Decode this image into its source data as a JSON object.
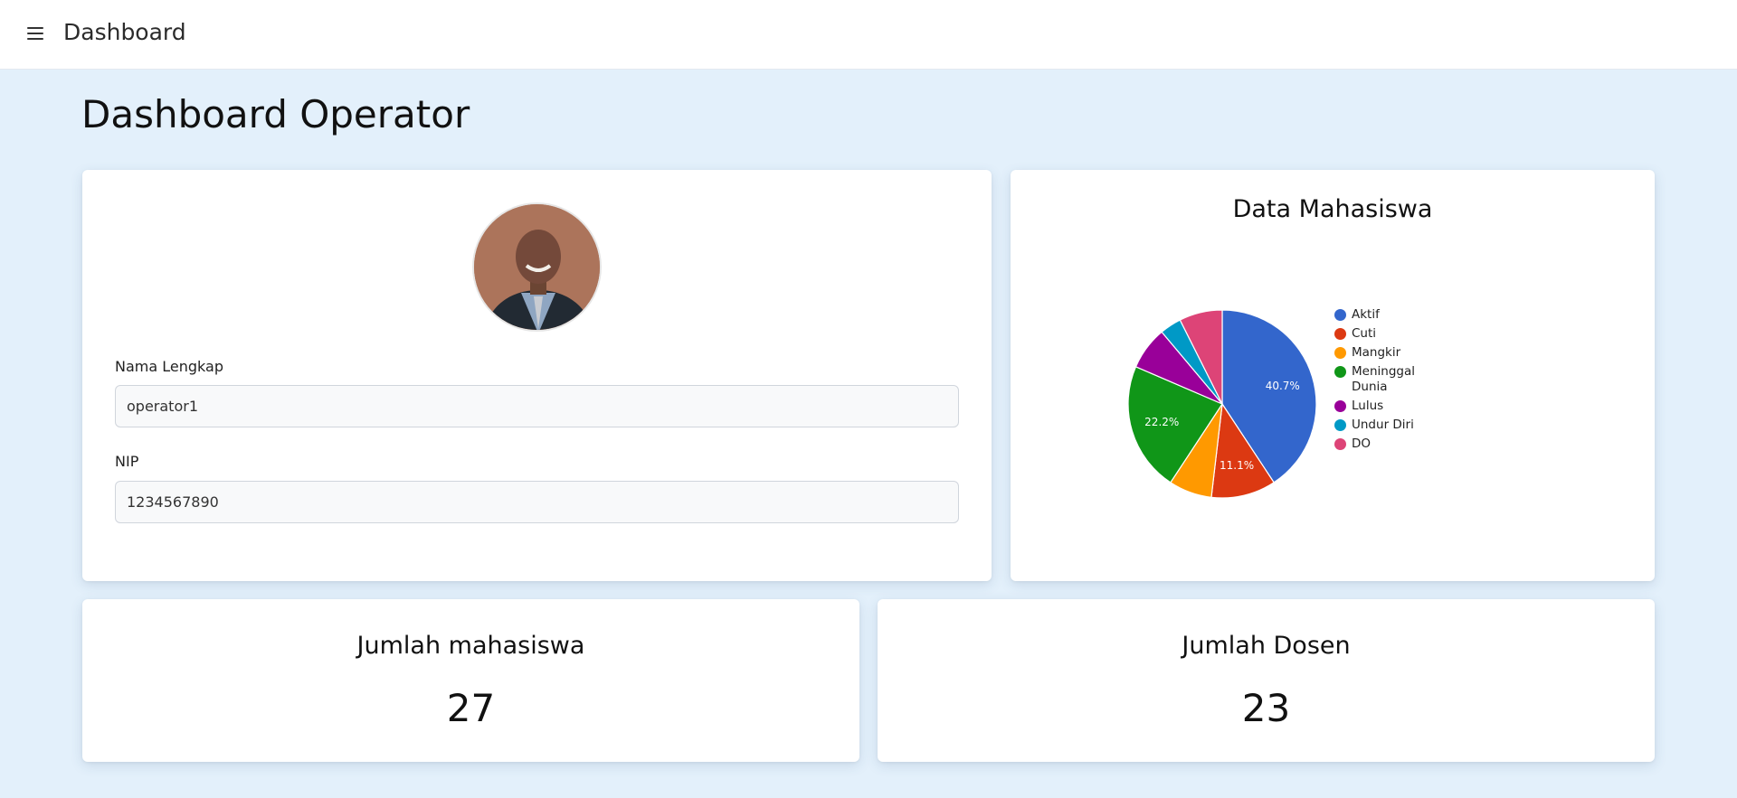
{
  "topbar": {
    "title": "Dashboard"
  },
  "page": {
    "title": "Dashboard Operator"
  },
  "profile": {
    "name_label": "Nama Lengkap",
    "name_value": "operator1",
    "nip_label": "NIP",
    "nip_value": "1234567890"
  },
  "chart_data": {
    "type": "pie",
    "title": "Data Mahasiswa",
    "categories": [
      "Aktif",
      "Cuti",
      "Mangkir",
      "Meninggal Dunia",
      "Lulus",
      "Undur Diri",
      "DO"
    ],
    "values": [
      11,
      3,
      2,
      6,
      2,
      1,
      2
    ],
    "colors": [
      "#3366cc",
      "#dc3912",
      "#ff9900",
      "#109618",
      "#990099",
      "#0099c6",
      "#dd4477"
    ],
    "slice_labels": [
      "40.7%",
      "11.1%",
      "",
      "22.2%",
      "",
      "",
      ""
    ],
    "legend_position": "right"
  },
  "stats": {
    "mahasiswa_title": "Jumlah mahasiswa",
    "mahasiswa_value": "27",
    "dosen_title": "Jumlah Dosen",
    "dosen_value": "23"
  }
}
